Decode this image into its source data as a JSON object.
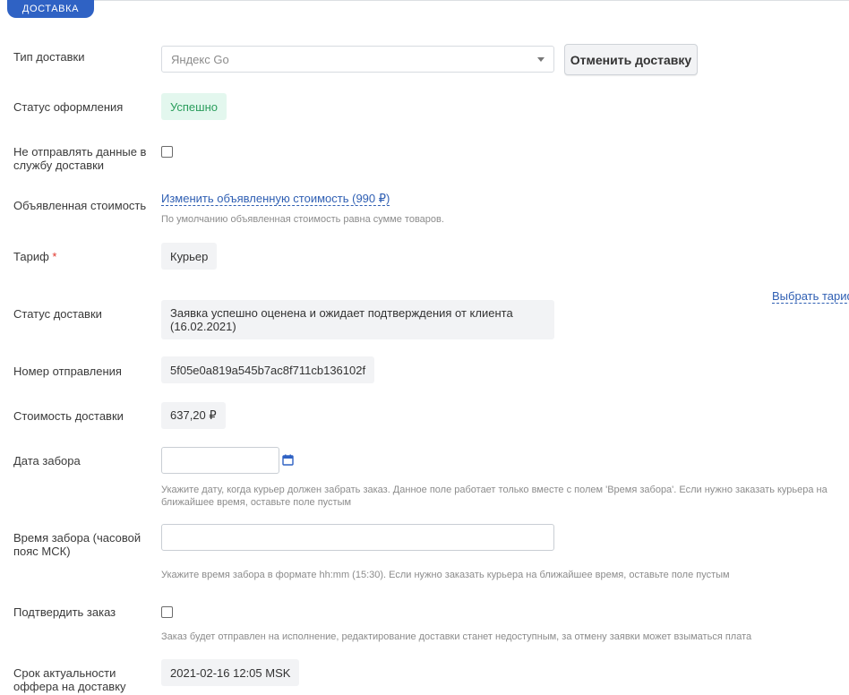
{
  "section": {
    "title": "ДОСТАВКА"
  },
  "delivery_type": {
    "label": "Тип доставки",
    "value": "Яндекс Go",
    "cancel_button": "Отменить доставку"
  },
  "registration_status": {
    "label": "Статус оформления",
    "value": "Успешно"
  },
  "dont_send": {
    "label_line1": "Не отправлять данные в",
    "label_line2": "службу доставки"
  },
  "declared_cost": {
    "label": "Объявленная стоимость",
    "link": "Изменить объявленную стоимость (990 ₽)",
    "hint": "По умолчанию объявленная стоимость равна сумме товаров."
  },
  "tariff": {
    "label": "Тариф",
    "required_mark": "*",
    "value": "Курьер",
    "choose_link": "Выбрать тариф"
  },
  "delivery_status": {
    "label": "Статус доставки",
    "value_line1": "Заявка успешно оценена и ожидает подтверждения от клиента",
    "value_line2": "(16.02.2021)"
  },
  "shipment_number": {
    "label": "Номер отправления",
    "value": "5f05e0a819a545b7ac8f711cb136102f"
  },
  "delivery_cost": {
    "label": "Стоимость доставки",
    "value": "637,20 ₽"
  },
  "pickup_date": {
    "label": "Дата забора",
    "value": "",
    "hint_line1": "Укажите дату, когда курьер должен забрать заказ. Данное поле работает только вместе с полем 'Время забора'. Если нужно заказать курьера на",
    "hint_line2": "ближайшее время, оставьте поле пустым"
  },
  "pickup_time": {
    "label_line1": "Время забора (часовой",
    "label_line2": "пояс МСК)",
    "value": "",
    "hint": "Укажите время забора в формате hh:mm (15:30). Если нужно заказать курьера на ближайшее время, оставьте поле пустым"
  },
  "confirm_order": {
    "label": "Подтвердить заказ",
    "hint": "Заказ будет отправлен на исполнение, редактирование доставки станет недоступным, за отмену заявки может взыматься плата"
  },
  "offer_validity": {
    "label_line1": "Срок актуальности",
    "label_line2": "оффера на доставку",
    "value": "2021-02-16 12:05 MSK"
  },
  "colors": {
    "accent": "#2f62c4",
    "link": "#2f5fb3",
    "success_bg": "#e3f7ee",
    "success_text": "#2a9d5c",
    "required": "#e0352b"
  }
}
